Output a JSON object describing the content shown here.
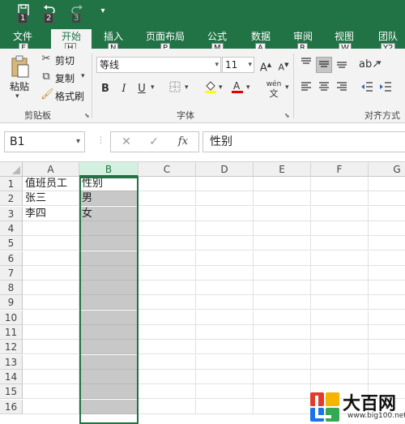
{
  "quick_access": {
    "save_icon": "save-icon",
    "undo_icon": "undo-icon",
    "redo_icon": "redo-icon",
    "customize_icon": "customize-icon",
    "keytips": [
      "1",
      "2",
      "3"
    ]
  },
  "tabs": [
    {
      "label": "文件",
      "keytip": "F"
    },
    {
      "label": "开始",
      "keytip": "H"
    },
    {
      "label": "插入",
      "keytip": "N"
    },
    {
      "label": "页面布局",
      "keytip": "P"
    },
    {
      "label": "公式",
      "keytip": "M"
    },
    {
      "label": "数据",
      "keytip": "A"
    },
    {
      "label": "审阅",
      "keytip": "R"
    },
    {
      "label": "视图",
      "keytip": "W"
    },
    {
      "label": "团队",
      "keytip": "Y2"
    }
  ],
  "ribbon": {
    "clipboard": {
      "paste_label": "粘贴",
      "cut_label": "剪切",
      "copy_label": "复制",
      "format_painter_label": "格式刷",
      "group_label": "剪贴板"
    },
    "font": {
      "font_name": "等线",
      "font_size": "11",
      "bold": "B",
      "italic": "I",
      "underline": "U",
      "phonetic": "wén",
      "group_label": "字体"
    },
    "alignment": {
      "group_label": "对齐方式"
    }
  },
  "formula_bar": {
    "name_box": "B1",
    "cancel": "✕",
    "enter": "✓",
    "fx": "fx",
    "formula": "性别"
  },
  "sheet": {
    "columns": [
      "A",
      "B",
      "C",
      "D",
      "E",
      "F",
      "G"
    ],
    "rows": [
      "1",
      "2",
      "3",
      "4",
      "5",
      "6",
      "7",
      "8",
      "9",
      "10",
      "11",
      "12",
      "13",
      "14",
      "15",
      "16"
    ],
    "cells": {
      "A1": "值班员工",
      "B1": "性别",
      "A2": " 张三",
      "B2": "男",
      "A3": "李四",
      "B3": "女"
    },
    "selected_column": "B",
    "active_cell": "B1"
  },
  "watermark": {
    "text": "大百网",
    "url": "www.big100.net"
  },
  "colors": {
    "accent": "#217346",
    "selection": "#c8c8c8"
  }
}
